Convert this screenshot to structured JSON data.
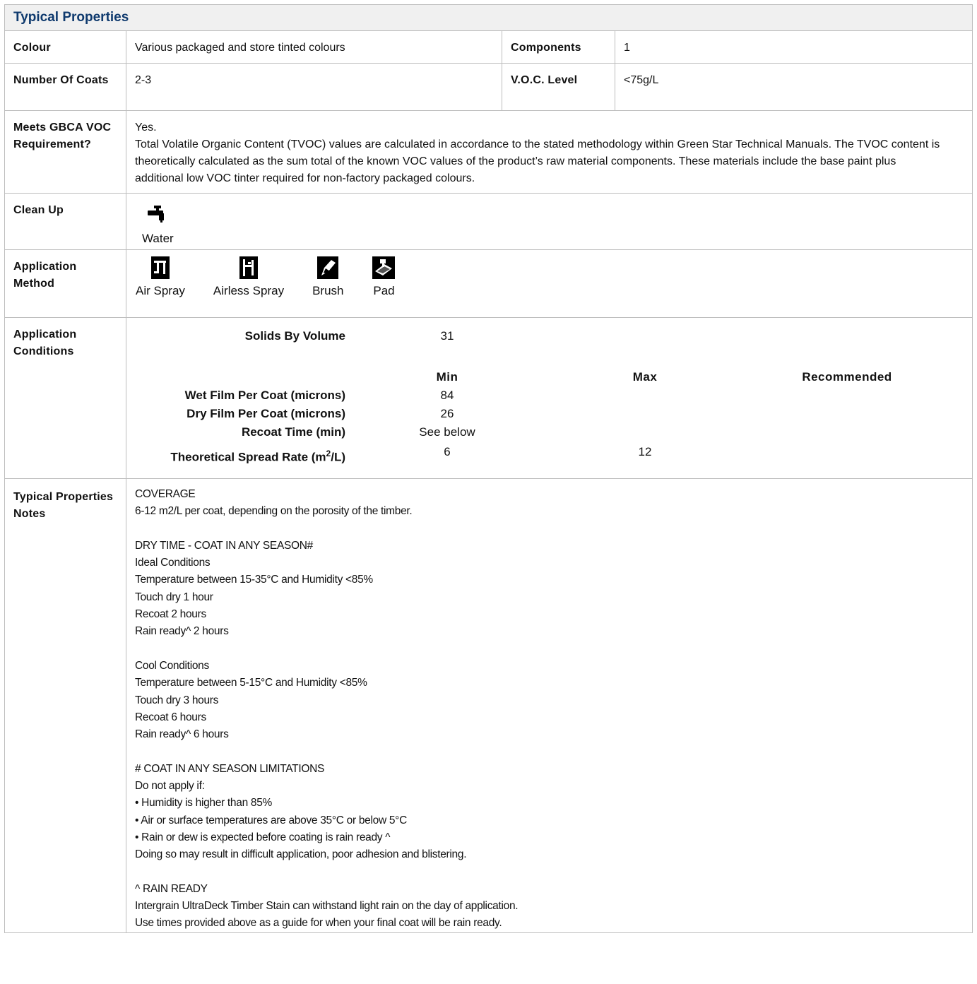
{
  "title": "Typical Properties",
  "rows": {
    "colour": {
      "label": "Colour",
      "value": "Various packaged and store tinted colours"
    },
    "components": {
      "label": "Components",
      "value": "1"
    },
    "coats": {
      "label": "Number Of Coats",
      "value": "2-3"
    },
    "voc": {
      "label": "V.O.C. Level",
      "value": "<75g/L"
    },
    "gbca": {
      "label": "Meets GBCA VOC Requirement?",
      "line1": "Yes.",
      "line2": "Total Volatile Organic Content (TVOC) values are calculated in accordance to the stated methodology within Green Star Technical Manuals. The TVOC content is theoretically calculated as the sum total of the known VOC values of the product’s raw material components. These materials include the base paint plus additional low VOC tinter required for non-factory packaged colours."
    },
    "cleanup": {
      "label": "Clean Up",
      "items": [
        {
          "icon": "tap-icon",
          "caption": "Water"
        }
      ]
    },
    "method": {
      "label": "Application Method",
      "items": [
        {
          "icon": "air-spray-icon",
          "caption": "Air Spray"
        },
        {
          "icon": "airless-spray-icon",
          "caption": "Airless Spray"
        },
        {
          "icon": "brush-icon",
          "caption": "Brush"
        },
        {
          "icon": "pad-icon",
          "caption": "Pad"
        }
      ]
    },
    "conditions": {
      "label": "Application Conditions",
      "solids": {
        "label": "Solids By Volume",
        "value": "31"
      },
      "headers": {
        "min": "Min",
        "max": "Max",
        "recommended": "Recommended"
      },
      "wet": {
        "label": "Wet Film Per Coat (microns)",
        "min": "84"
      },
      "dry": {
        "label": "Dry Film Per Coat (microns)",
        "min": "26"
      },
      "recoat": {
        "label": "Recoat Time (min)",
        "min": "See below"
      },
      "spread": {
        "label_a": "Theoretical Spread Rate (m",
        "sup": "2",
        "label_b": "/L)",
        "min": "6",
        "max": "12"
      }
    },
    "notes": {
      "label": "Typical Properties Notes",
      "lines": [
        "COVERAGE",
        "6-12 m2/L per coat, depending on the porosity of the timber.",
        "",
        "DRY TIME - COAT IN ANY SEASON#",
        "Ideal Conditions",
        "Temperature between 15-35°C and Humidity <85%",
        "Touch dry 1 hour",
        "Recoat 2 hours",
        "Rain ready^ 2 hours",
        "",
        "Cool Conditions",
        "Temperature between 5-15°C and Humidity <85%",
        "Touch dry 3 hours",
        "Recoat 6 hours",
        "Rain ready^ 6 hours",
        "",
        "# COAT IN ANY SEASON LIMITATIONS",
        "Do not apply if:",
        "• Humidity is higher than 85%",
        "• Air or surface temperatures are above 35°C or below 5°C",
        "• Rain or dew is expected before coating is rain ready ^",
        "Doing so may result in difficult application, poor adhesion and blistering.",
        "",
        "^ RAIN READY",
        "Intergrain UltraDeck Timber Stain can withstand light rain on the day of application.",
        "Use times provided above as a guide for when your final coat will be rain ready."
      ]
    }
  }
}
